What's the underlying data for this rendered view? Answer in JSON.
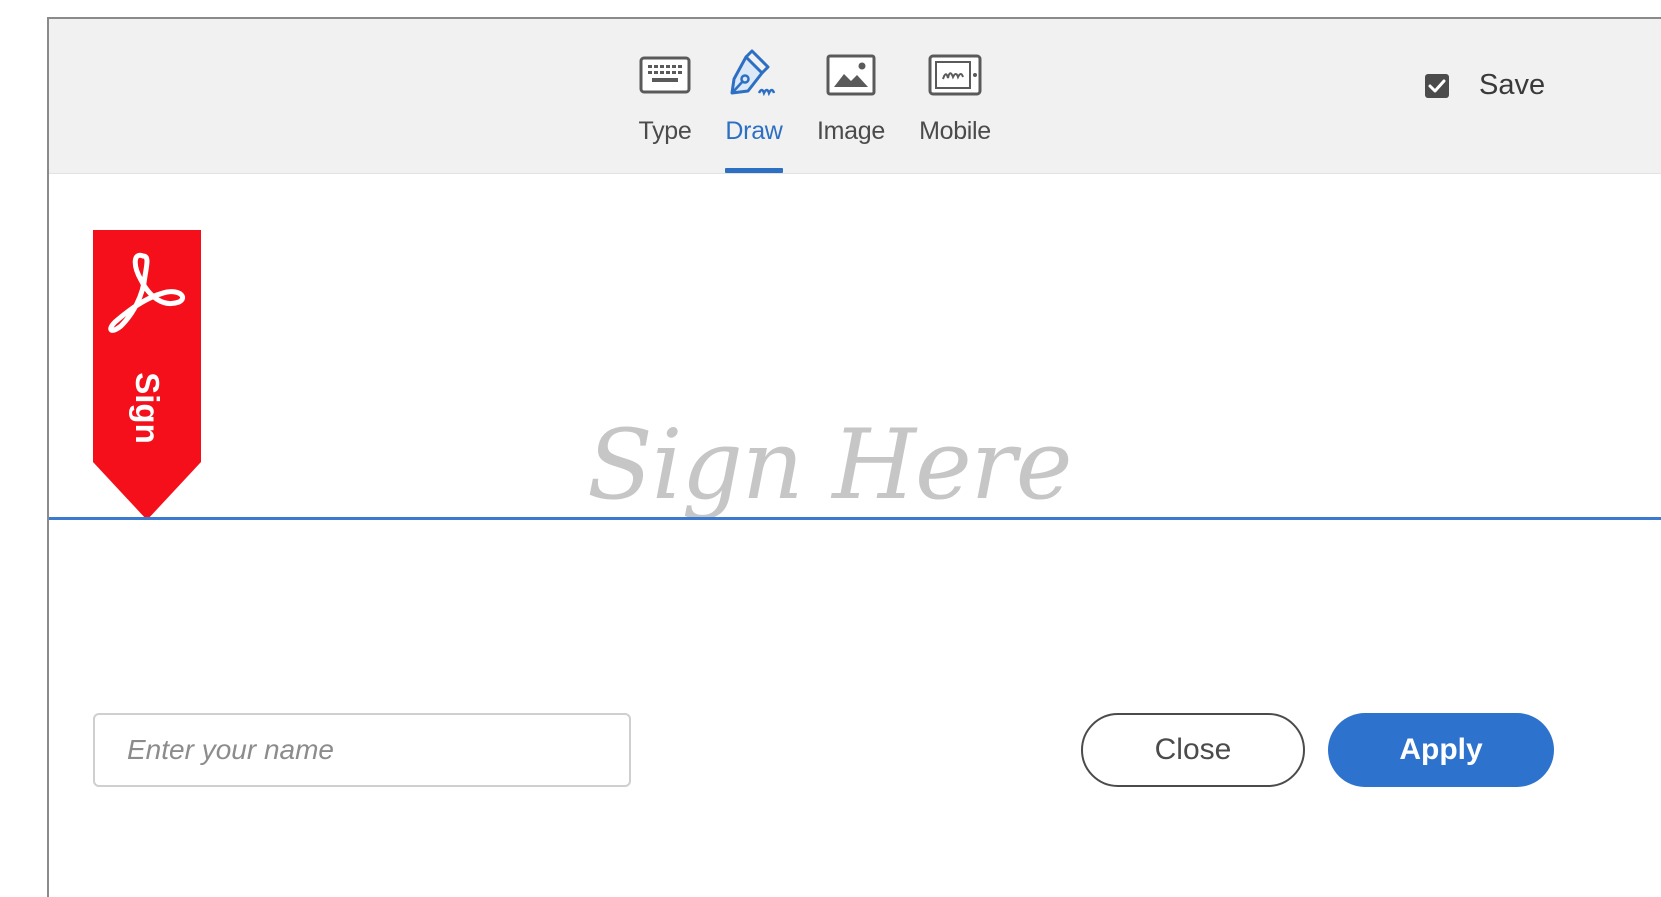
{
  "toolbar": {
    "tabs": [
      {
        "label": "Type",
        "icon": "keyboard-icon"
      },
      {
        "label": "Draw",
        "icon": "pen-icon",
        "active": true
      },
      {
        "label": "Image",
        "icon": "image-icon"
      },
      {
        "label": "Mobile",
        "icon": "mobile-icon"
      }
    ],
    "save": {
      "label": "Save",
      "checked": true
    }
  },
  "banner": {
    "label": "Sign",
    "color": "#f40f1a",
    "icon": "acrobat-icon"
  },
  "signature_area": {
    "placeholder": "Sign Here",
    "line_color": "#3a7ad0"
  },
  "footer": {
    "name_input": {
      "placeholder": "Enter your name",
      "value": ""
    },
    "close_label": "Close",
    "apply_label": "Apply"
  },
  "colors": {
    "accent": "#2d6fc2",
    "toolbar_bg": "#f1f1f1"
  }
}
